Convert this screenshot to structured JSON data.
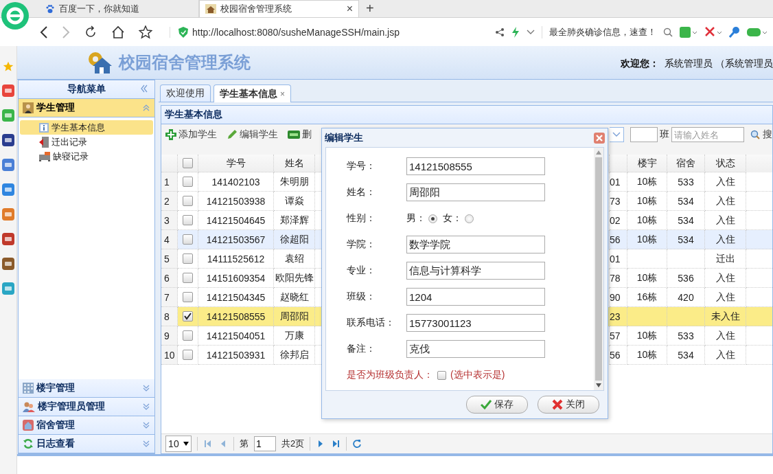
{
  "browser": {
    "tabs": [
      {
        "label": "百度一下，你就知道",
        "selected": false,
        "kind": "paw"
      },
      {
        "label": "校园宿舍管理系统",
        "selected": true,
        "kind": "house",
        "close": "×"
      }
    ],
    "new_tab": "+",
    "address": "http://localhost:8080/susheManageSSH/main.jsp",
    "search_hint": "最全肺炎确诊信息，速查！"
  },
  "header": {
    "title": "校园宿舍管理系统",
    "welcome_label": "欢迎您：",
    "user": "系统管理员 （系统管理员"
  },
  "nav": {
    "title": "导航菜单",
    "panels": [
      {
        "label": "学生管理",
        "expanded": true,
        "kind": "student",
        "items": [
          {
            "label": "学生基本信息",
            "selected": true,
            "kind": "info"
          },
          {
            "label": "迁出记录",
            "selected": false,
            "kind": "out"
          },
          {
            "label": "缺寝记录",
            "selected": false,
            "kind": "absent"
          }
        ]
      },
      {
        "label": "楼宇管理",
        "expanded": false,
        "kind": "building"
      },
      {
        "label": "楼宇管理员管理",
        "expanded": false,
        "kind": "people"
      },
      {
        "label": "宿舍管理",
        "expanded": false,
        "kind": "dorm"
      },
      {
        "label": "日志查看",
        "expanded": false,
        "kind": "log"
      }
    ]
  },
  "tabs": [
    {
      "label": "欢迎使用",
      "selected": false
    },
    {
      "label": "学生基本信息",
      "selected": true,
      "close": "×"
    }
  ],
  "panel_title": "学生基本信息",
  "toolbar": {
    "buttons": [
      {
        "label": "添加学生",
        "kind": "add"
      },
      {
        "label": "编辑学生",
        "kind": "edit"
      },
      {
        "label": "删",
        "kind": "delete"
      }
    ],
    "class_suffix": "班",
    "name_placeholder": "请输入姓名",
    "search_label": "搜"
  },
  "table": {
    "all_selected": false,
    "columns": [
      "学号",
      "姓名",
      "楼宇",
      "宿舍",
      "状态"
    ],
    "rows": [
      {
        "index": "1",
        "selected": false,
        "hovered": false,
        "id": "141402103",
        "name": "朱明朋",
        "column_5": "01",
        "building": "10栋",
        "room": "533",
        "status": "入住"
      },
      {
        "index": "2",
        "selected": false,
        "hovered": false,
        "id": "14121503938",
        "name": "谭焱",
        "column_5": "73",
        "building": "10栋",
        "room": "534",
        "status": "入住"
      },
      {
        "index": "3",
        "selected": false,
        "hovered": false,
        "id": "14121504645",
        "name": "郑泽辉",
        "column_5": "02",
        "building": "10栋",
        "room": "534",
        "status": "入住"
      },
      {
        "index": "4",
        "selected": false,
        "hovered": true,
        "id": "14121503567",
        "name": "徐超阳",
        "column_5": "56",
        "building": "10栋",
        "room": "534",
        "status": "入住"
      },
      {
        "index": "5",
        "selected": false,
        "hovered": false,
        "id": "14111525612",
        "name": "袁绍",
        "column_5": "01",
        "building": "",
        "room": "",
        "status": "迁出"
      },
      {
        "index": "6",
        "selected": false,
        "hovered": false,
        "id": "14151609354",
        "name": "欧阳先锋",
        "column_5": "78",
        "building": "10栋",
        "room": "536",
        "status": "入住"
      },
      {
        "index": "7",
        "selected": false,
        "hovered": false,
        "id": "14121504345",
        "name": "赵晓红",
        "column_5": "90",
        "building": "16栋",
        "room": "420",
        "status": "入住"
      },
      {
        "index": "8",
        "selected": true,
        "hovered": false,
        "id": "14121508555",
        "name": "周邵阳",
        "column_5": "23",
        "building": "",
        "room": "",
        "status": "未入住"
      },
      {
        "index": "9",
        "selected": false,
        "hovered": false,
        "id": "14121504051",
        "name": "万康",
        "column_5": "57",
        "building": "10栋",
        "room": "533",
        "status": "入住"
      },
      {
        "index": "10",
        "selected": false,
        "hovered": false,
        "id": "14121503931",
        "name": "徐邦启",
        "column_5": "56",
        "building": "10栋",
        "room": "534",
        "status": "入住"
      }
    ]
  },
  "pager": {
    "page_size": "10",
    "page_label": "第",
    "page": "1",
    "total": "共2页"
  },
  "dialog": {
    "title": "编辑学生",
    "fields": [
      {
        "kind": "text",
        "label": "学号：",
        "value": "14121508555"
      },
      {
        "kind": "text",
        "label": "姓名：",
        "value": "周邵阳"
      },
      {
        "kind": "radio",
        "label": "性别：",
        "options": [
          {
            "label": "男：",
            "selected": true
          },
          {
            "label": "女：",
            "selected": false
          }
        ]
      },
      {
        "kind": "text",
        "label": "学院：",
        "value": "数学学院"
      },
      {
        "kind": "text",
        "label": "专业：",
        "value": "信息与计算科学"
      },
      {
        "kind": "text",
        "label": "班级：",
        "value": "1204"
      },
      {
        "kind": "text",
        "label": "联系电话：",
        "value": "15773001123"
      },
      {
        "kind": "text",
        "label": "备注：",
        "value": "克伐"
      },
      {
        "kind": "checkbox",
        "label": "是否为班级负责人：",
        "checked": false,
        "hint": "(选中表示是)"
      }
    ],
    "buttons": [
      {
        "label": "保存",
        "kind": "save"
      },
      {
        "label": "关闭",
        "kind": "close"
      }
    ]
  }
}
